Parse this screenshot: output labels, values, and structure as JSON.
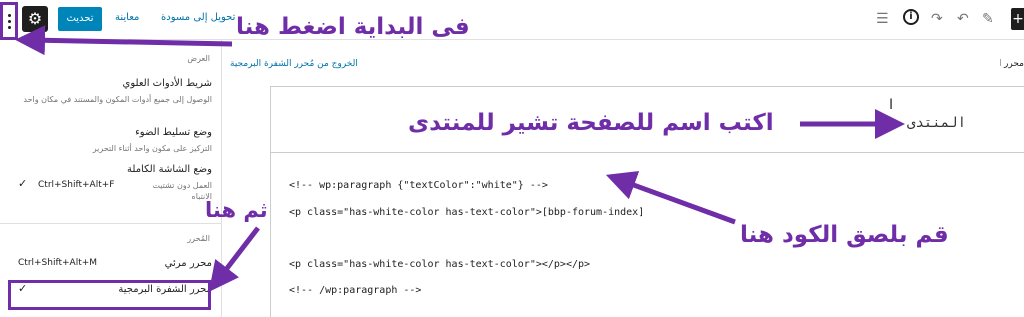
{
  "toolbar": {
    "settings_icon": "gear-icon",
    "options_icon": "kebab-vertical-icon",
    "update_label": "تحديث",
    "preview_label": "معاينة",
    "draft_label": "تحويل إلى مسودة",
    "tools": [
      "block-nav-icon",
      "info-icon",
      "redo-icon",
      "undo-icon",
      "pencil-icon",
      "add-icon"
    ],
    "info_glyph": "i"
  },
  "sidebar": {
    "view_section_title": "العرض",
    "items": [
      {
        "label": "شريط الأدوات العلوي",
        "desc": "الوصول إلى جميع أدوات المكون والمستند في مكان واحد"
      },
      {
        "label": "وضع تسليط الضوء",
        "desc": "التركيز على مكون واحد أثناء التحرير"
      },
      {
        "label": "وضع الشاشة الكاملة",
        "desc": "العمل دون تشتيت الانتباه",
        "shortcut": "Ctrl+Shift+Alt+F",
        "checked": true
      }
    ],
    "editor_section_title": "المُحرر",
    "visual_editor": {
      "label": "محرر مرئي",
      "shortcut": "Ctrl+Shift+Alt+M"
    },
    "code_editor": {
      "label": "مُحرر الشفرة البرمجية",
      "checked": true
    }
  },
  "editor": {
    "exit_code_editor": "الخروج من مُحرر الشفرة البرمجية",
    "right_title": "محرر الشفرة البرمجية",
    "post_title": "المنتدى",
    "code_lines": [
      "<!-- wp:paragraph {\"textColor\":\"white\"} -->",
      "<p class=\"has-white-color has-text-color\">[bbp-forum-index]",
      "<p class=\"has-white-color has-text-color\"></p></p>",
      "<!-- /wp:paragraph -->"
    ]
  },
  "annotations": {
    "start_here": "فى البداية اضغط هنا",
    "then_here": "ثم هنا",
    "write_name": "اكتب اسم للصفحة تشير للمنتدى",
    "paste_code": "قم بلصق الكود هنا"
  },
  "colors": {
    "annotation": "#6f2da8",
    "primary": "#0085ba",
    "link": "#0073aa"
  }
}
